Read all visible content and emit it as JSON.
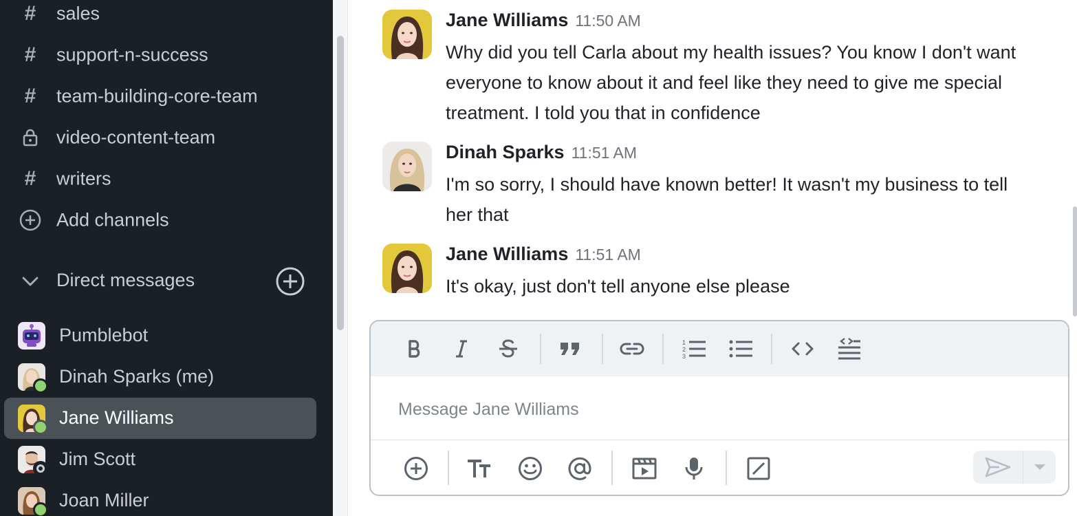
{
  "sidebar": {
    "channels": [
      {
        "icon": "hash-icon",
        "label": "sales"
      },
      {
        "icon": "hash-icon",
        "label": "support-n-success"
      },
      {
        "icon": "hash-icon",
        "label": "team-building-core-team"
      },
      {
        "icon": "lock-icon",
        "label": "video-content-team"
      },
      {
        "icon": "hash-icon",
        "label": "writers"
      }
    ],
    "add_channels_label": "Add channels",
    "dm_section_title": "Direct messages",
    "direct_messages": [
      {
        "name": "Pumblebot",
        "status": "none"
      },
      {
        "name": "Dinah Sparks (me)",
        "status": "online"
      },
      {
        "name": "Jane Williams",
        "status": "online",
        "active": true
      },
      {
        "name": "Jim Scott",
        "status": "away"
      },
      {
        "name": "Joan Miller",
        "status": "online"
      }
    ]
  },
  "messages": [
    {
      "author": "Jane Williams",
      "time": "11:50 AM",
      "text": "Why did you tell Carla about my health issues? You know I don't want everyone to know about it and feel like they need to give me special treatment. I told you that in confidence"
    },
    {
      "author": "Dinah Sparks",
      "time": "11:51 AM",
      "text": "I'm so sorry, I should have known better! It wasn't my business to tell her that"
    },
    {
      "author": "Jane Williams",
      "time": "11:51 AM",
      "text": "It's okay, just don't tell anyone else please"
    }
  ],
  "composer": {
    "placeholder": "Message Jane Williams",
    "value": "",
    "formatting_tools": [
      "bold-icon",
      "italic-icon",
      "strikethrough-icon",
      "quote-icon",
      "link-icon",
      "ordered-list-icon",
      "bullet-list-icon",
      "code-icon",
      "code-block-icon"
    ],
    "action_tools": [
      "attach-plus-icon",
      "text-format-icon",
      "emoji-icon",
      "mention-icon",
      "video-clip-icon",
      "microphone-icon",
      "slash-command-icon"
    ]
  },
  "colors": {
    "sidebar_bg": "#1b2026",
    "active_item_bg": "#4b5257",
    "online": "#8fd26f"
  }
}
